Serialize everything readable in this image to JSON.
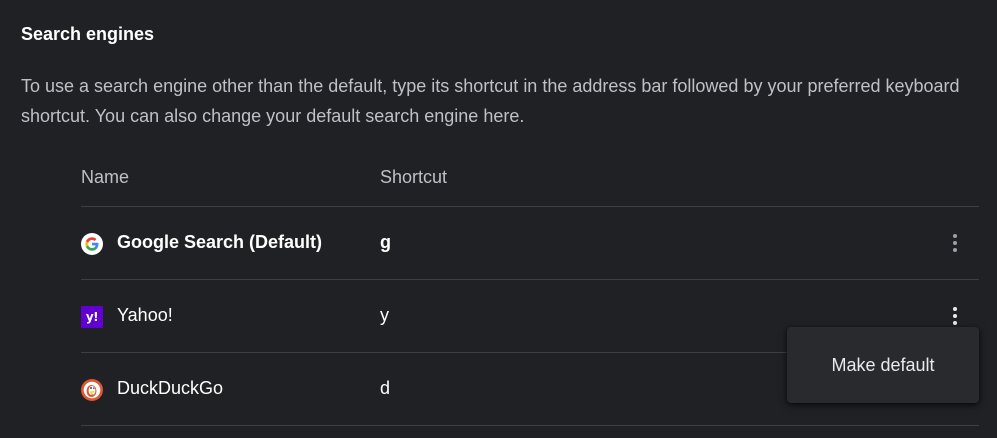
{
  "section": {
    "title": "Search engines",
    "description": "To use a search engine other than the default, type its shortcut in the address bar followed by your preferred keyboard shortcut. You can also change your default search engine here."
  },
  "table": {
    "headers": {
      "name": "Name",
      "shortcut": "Shortcut"
    },
    "engines": [
      {
        "name": "Google Search (Default)",
        "shortcut": "g",
        "icon": "google-icon",
        "is_default": true
      },
      {
        "name": "Yahoo!",
        "shortcut": "y",
        "icon": "yahoo-icon",
        "icon_text": "y!",
        "is_default": false
      },
      {
        "name": "DuckDuckGo",
        "shortcut": "d",
        "icon": "duckduckgo-icon",
        "is_default": false
      }
    ]
  },
  "context_menu": {
    "open_for": "Yahoo!",
    "items": [
      {
        "label": "Make default"
      }
    ]
  },
  "colors": {
    "background": "#202124",
    "text_primary": "#ffffff",
    "text_secondary": "#bdc1c6",
    "divider": "#3c4043",
    "menu_background": "#292a2d",
    "yahoo_purple": "#6001d2",
    "duckduckgo_orange": "#de5833"
  }
}
